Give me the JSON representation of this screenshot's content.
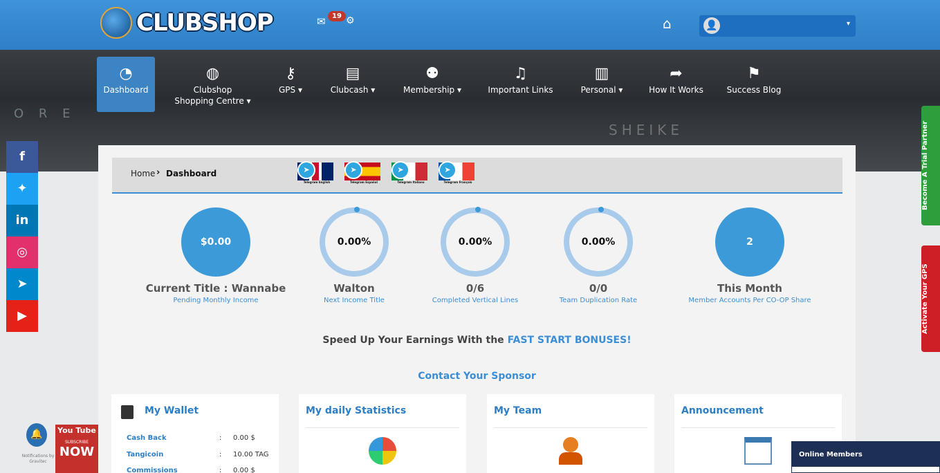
{
  "topbar": {
    "logo_text": "CLUBSHOP",
    "mail_icon": "envelope-icon",
    "mail_count": "19",
    "settings_icon": "gear-icon",
    "home_icon": "home-icon"
  },
  "nav": [
    {
      "label": "Dashboard",
      "icon": "tachometer-icon",
      "active": true
    },
    {
      "label": "Clubshop",
      "label2": "Shopping Centre ▾",
      "icon": "globe-icon"
    },
    {
      "label": "GPS ▾",
      "icon": "key-icon"
    },
    {
      "label": "Clubcash ▾",
      "icon": "briefcase-icon"
    },
    {
      "label": "Membership ▾",
      "icon": "users-icon"
    },
    {
      "label": "Important Links",
      "icon": "bell-icon"
    },
    {
      "label": "Personal ▾",
      "icon": "suitcase-icon"
    },
    {
      "label": "How It Works",
      "icon": "share-icon"
    },
    {
      "label": "Success Blog",
      "icon": "flag-icon"
    }
  ],
  "social": [
    "facebook-icon",
    "twitter-icon",
    "linkedin-icon",
    "instagram-icon",
    "telegram-icon",
    "youtube-icon"
  ],
  "right_tabs": {
    "trial": "Become A Trial Partner",
    "gps": "Activate Your GPS"
  },
  "breadcrumb": {
    "home": "Home",
    "current": "Dashboard"
  },
  "telegram": [
    {
      "caption": "Telegram English",
      "colors": [
        "#012169",
        "#ffffff",
        "#c8102e"
      ]
    },
    {
      "caption": "Telegram Español",
      "colors": [
        "#c60b1e",
        "#ffc400",
        "#c60b1e"
      ]
    },
    {
      "caption": "Telegram Italiano",
      "colors": [
        "#009246",
        "#ffffff",
        "#ce2b37"
      ]
    },
    {
      "caption": "Telegram Français",
      "colors": [
        "#0055a4",
        "#ffffff",
        "#ef4135"
      ]
    }
  ],
  "stats": [
    {
      "value": "$0.00",
      "title": "Current Title : Wannabe",
      "sub": "Pending Monthly Income",
      "style": "filled"
    },
    {
      "value": "0.00%",
      "title": "Walton",
      "sub": "Next Income Title",
      "style": "ring"
    },
    {
      "value": "0.00%",
      "title": "0/6",
      "sub": "Completed Vertical Lines",
      "style": "ring"
    },
    {
      "value": "0.00%",
      "title": "0/0",
      "sub": "Team Duplication Rate",
      "style": "ring"
    },
    {
      "value": "2",
      "title": "This Month",
      "sub": "Member Accounts Per CO-OP Share",
      "style": "filled"
    }
  ],
  "fast_start": {
    "prefix": "Speed Up Your Earnings With the ",
    "highlight": "FAST START BONUSES!"
  },
  "contact": "Contact Your Sponsor",
  "cards": {
    "wallet": {
      "title": "My Wallet",
      "rows": [
        {
          "label": "Cash Back",
          "value": "0.00 $"
        },
        {
          "label": "Tangicoin",
          "value": "10.00 TAG"
        },
        {
          "label": "Commissions",
          "value": "0.00 $"
        }
      ]
    },
    "stats": {
      "title": "My daily Statistics"
    },
    "team": {
      "title": "My Team"
    },
    "announce": {
      "title": "Announcement"
    }
  },
  "notifications": "Notifications by Gravitec",
  "youtube": {
    "tube": "You Tube",
    "subscribe": "SUBSCRIBE",
    "now": "NOW"
  },
  "online": {
    "title": "Online Members"
  }
}
